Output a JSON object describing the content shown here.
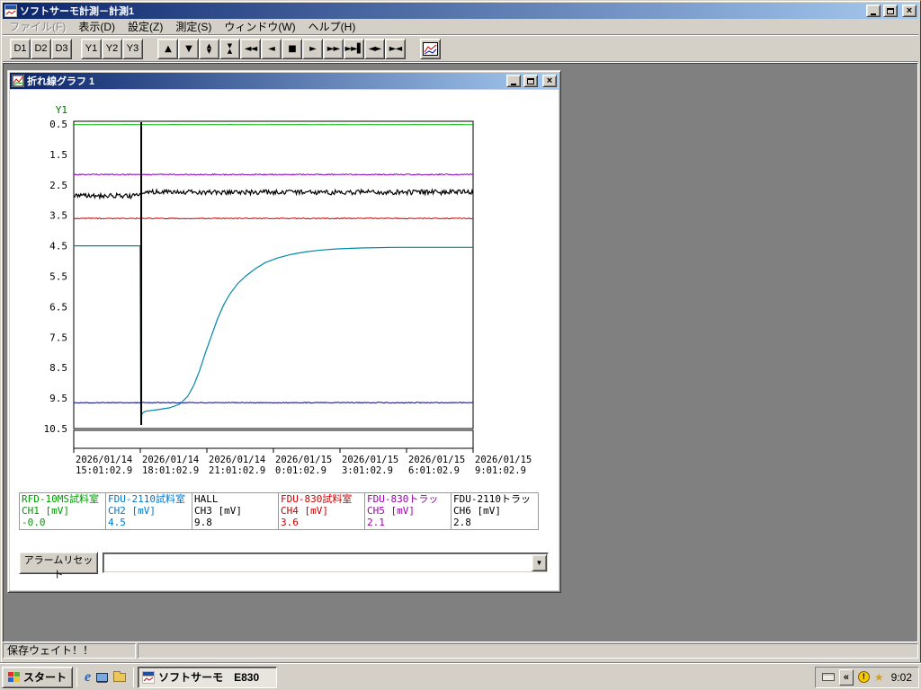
{
  "icons": {
    "close": "×",
    "dropdown_arrow": "▼",
    "tray_collapse": "«",
    "alert_glyph": "!",
    "star": "★",
    "ie_glyph": "e"
  },
  "window": {
    "title": "ソフトサーモ計測－計測1"
  },
  "menu": {
    "items": [
      {
        "id": "file",
        "label": "ファイル(F)",
        "enabled": false
      },
      {
        "id": "view",
        "label": "表示(D)",
        "enabled": true
      },
      {
        "id": "settings",
        "label": "設定(Z)",
        "enabled": true
      },
      {
        "id": "measure",
        "label": "測定(S)",
        "enabled": true
      },
      {
        "id": "window",
        "label": "ウィンドウ(W)",
        "enabled": true
      },
      {
        "id": "help",
        "label": "ヘルプ(H)",
        "enabled": true
      }
    ]
  },
  "toolbar": {
    "display_buttons": [
      {
        "id": "d1",
        "label": "D1"
      },
      {
        "id": "d2",
        "label": "D2"
      },
      {
        "id": "d3",
        "label": "D3"
      }
    ],
    "axis_buttons": [
      {
        "id": "y1",
        "label": "Y1"
      },
      {
        "id": "y2",
        "label": "Y2"
      },
      {
        "id": "y3",
        "label": "Y3"
      }
    ],
    "nav_buttons": [
      {
        "id": "scroll-up",
        "glyph": "▲"
      },
      {
        "id": "scroll-down",
        "glyph": "▼"
      },
      {
        "id": "expand-vertical",
        "glyph": "▲▼",
        "stack": true
      },
      {
        "id": "compress-vertical",
        "glyph": "▼▲",
        "stack": true
      },
      {
        "id": "rewind",
        "glyph": "◄◄"
      },
      {
        "id": "step-back",
        "glyph": "◄"
      },
      {
        "id": "stop",
        "glyph": "■"
      },
      {
        "id": "step-forward",
        "glyph": "►"
      },
      {
        "id": "fast-forward",
        "glyph": "►►"
      },
      {
        "id": "skip-to-end",
        "glyph": "►►▌"
      },
      {
        "id": "expand-horizontal",
        "glyph": "◄►"
      },
      {
        "id": "collapse-horizontal",
        "glyph": "►◄"
      }
    ]
  },
  "graph_window": {
    "title": "折れ線グラフ 1"
  },
  "chart_data": {
    "type": "line",
    "title": "折れ線グラフ 1",
    "y_axis": {
      "label": "Y1",
      "label_color": "#007000",
      "min": 0.5,
      "max": 10.5,
      "inverted": true,
      "ticks": [
        0.5,
        1.5,
        2.5,
        3.5,
        4.5,
        5.5,
        6.5,
        7.5,
        8.5,
        9.5,
        10.5
      ]
    },
    "x_ticks": [
      {
        "date": "2026/01/14",
        "time": "15:01:02.9"
      },
      {
        "date": "2026/01/14",
        "time": "18:01:02.9"
      },
      {
        "date": "2026/01/14",
        "time": "21:01:02.9"
      },
      {
        "date": "2026/01/15",
        "time": "0:01:02.9"
      },
      {
        "date": "2026/01/15",
        "time": "3:01:02.9"
      },
      {
        "date": "2026/01/15",
        "time": "6:01:02.9"
      },
      {
        "date": "2026/01/15",
        "time": "9:01:02.9"
      }
    ],
    "event_marker": {
      "x_fraction": 0.169
    },
    "series": [
      {
        "name": "CH1",
        "color": "#00bb00",
        "noise": 0.004,
        "base_points": [
          [
            0,
            0.52
          ],
          [
            1,
            0.52
          ]
        ]
      },
      {
        "name": "CH5",
        "color": "#8800bb",
        "noise": 0.02,
        "base_points": [
          [
            0,
            2.16
          ],
          [
            1,
            2.16
          ]
        ]
      },
      {
        "name": "CH4",
        "color": "#cc0000",
        "noise": 0.015,
        "base_points": [
          [
            0,
            3.6
          ],
          [
            1,
            3.6
          ]
        ]
      },
      {
        "name": "CH3",
        "color": "#000088",
        "noise": 0.012,
        "base_points": [
          [
            0,
            9.65
          ],
          [
            1,
            9.65
          ]
        ]
      },
      {
        "name": "CH6",
        "color": "#000000",
        "noise": 0.08,
        "width": 1.2,
        "base_points": [
          [
            0,
            2.86
          ],
          [
            0.166,
            2.86
          ],
          [
            0.172,
            2.74
          ],
          [
            1,
            2.74
          ]
        ]
      },
      {
        "name": "CH2",
        "color": "#0088aa",
        "width": 1.2,
        "points": [
          [
            0,
            4.5
          ],
          [
            0.166,
            4.5
          ],
          [
            0.168,
            10.33
          ],
          [
            0.171,
            10.0
          ],
          [
            0.18,
            9.93
          ],
          [
            0.21,
            9.88
          ],
          [
            0.24,
            9.82
          ],
          [
            0.265,
            9.7
          ],
          [
            0.285,
            9.45
          ],
          [
            0.3,
            9.1
          ],
          [
            0.315,
            8.6
          ],
          [
            0.33,
            8.0
          ],
          [
            0.345,
            7.45
          ],
          [
            0.36,
            6.9
          ],
          [
            0.375,
            6.45
          ],
          [
            0.39,
            6.1
          ],
          [
            0.41,
            5.75
          ],
          [
            0.43,
            5.5
          ],
          [
            0.455,
            5.25
          ],
          [
            0.48,
            5.05
          ],
          [
            0.51,
            4.9
          ],
          [
            0.545,
            4.78
          ],
          [
            0.58,
            4.7
          ],
          [
            0.62,
            4.64
          ],
          [
            0.66,
            4.6
          ],
          [
            0.72,
            4.57
          ],
          [
            0.8,
            4.55
          ],
          [
            1,
            4.55
          ]
        ]
      }
    ]
  },
  "legend": {
    "channels": [
      {
        "name": "RFD-10MS試料室",
        "ch": "CH1 [mV]",
        "value": "-0.0",
        "color": "#009900"
      },
      {
        "name": "FDU-2110試料室",
        "ch": "CH2 [mV]",
        "value": "4.5",
        "color": "#0077cc"
      },
      {
        "name": "HALL",
        "ch": "CH3 [mV]",
        "value": "9.8",
        "color": "#000000"
      },
      {
        "name": "FDU-830試料室",
        "ch": "CH4 [mV]",
        "value": "3.6",
        "color": "#cc0000"
      },
      {
        "name": "FDU-830トラッ",
        "ch": "CH5 [mV]",
        "value": "2.1",
        "color": "#9900aa"
      },
      {
        "name": "FDU-2110トラッ",
        "ch": "CH6 [mV]",
        "value": "2.8",
        "color": "#000000"
      }
    ]
  },
  "alarm": {
    "reset_label": "アラームリセット",
    "combo_value": ""
  },
  "status": {
    "message": "保存ウェイト！！"
  },
  "taskbar": {
    "start_label": "スタート",
    "task_label": "ソフトサーモ　E830",
    "clock": "9:02"
  }
}
